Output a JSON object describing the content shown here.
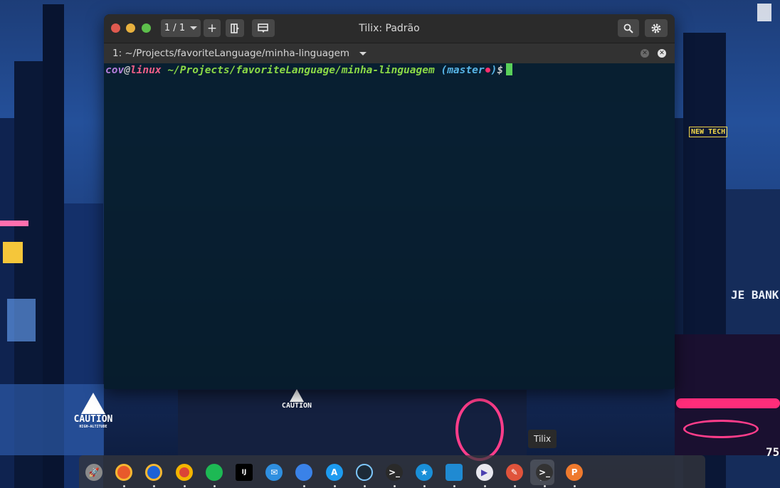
{
  "window": {
    "title": "Tilix: Padrão",
    "session_label": "1 / 1",
    "add_label": "+",
    "tab_label": "1: ~/Projects/favoriteLanguage/minha-linguagem"
  },
  "terminal": {
    "user": "cov",
    "at": "@",
    "host": "linux",
    "path": "~/Projects/favoriteLanguage/minha-linguagem",
    "paren_open": "(",
    "branch": "master",
    "paren_close": ")",
    "symbol": "$"
  },
  "colors": {
    "user": "#b57edc",
    "at": "#c0c0c0",
    "host": "#ef5e86",
    "path": "#8bd846",
    "branch": "#57b4e6",
    "dirty_dot": "#ff2d6d",
    "cursor": "#59d05a",
    "close_dot": "#e05a4f",
    "min_dot": "#e8b13e",
    "max_dot": "#5dbf4b"
  },
  "wallpaper_signs": {
    "new_tech": "NEW TECH",
    "je_bank": "JE BANK",
    "caution_left": "CAUTION",
    "caution_left_sub": "HIGH-ALTITUDE",
    "caution_mid": "CAUTION",
    "number": "75"
  },
  "dock": {
    "tooltip": "Tilix",
    "apps": [
      {
        "name": "rocket-icon",
        "glyph": "🚀",
        "color": "#8a8a8a"
      },
      {
        "name": "firefox-icon",
        "glyph": "",
        "color": "#e8592b"
      },
      {
        "name": "firefox-dev-icon",
        "glyph": "",
        "color": "#1d61d6"
      },
      {
        "name": "chrome-icon",
        "glyph": "",
        "color": "#db4437"
      },
      {
        "name": "spotify-icon",
        "glyph": "",
        "color": "#1db954"
      },
      {
        "name": "intellij-icon",
        "glyph": "IJ",
        "color": "#000000"
      },
      {
        "name": "mail-icon",
        "glyph": "✉",
        "color": "#2f8fe0"
      },
      {
        "name": "finder-icon",
        "glyph": "",
        "color": "#3a82e8"
      },
      {
        "name": "appstore-icon",
        "glyph": "A",
        "color": "#1d9bf0"
      },
      {
        "name": "gauge-icon",
        "glyph": "",
        "color": "#1d2b38"
      },
      {
        "name": "terminal-icon",
        "glyph": ">_",
        "color": "#2a2a2a"
      },
      {
        "name": "star-icon",
        "glyph": "★",
        "color": "#1a8fd8"
      },
      {
        "name": "vscode-icon",
        "glyph": "",
        "color": "#1f8ad2"
      },
      {
        "name": "media-player-icon",
        "glyph": "▶",
        "color": "#e8e8ef"
      },
      {
        "name": "pencil-icon",
        "glyph": "✎",
        "color": "#e0533b"
      },
      {
        "name": "tilix-icon",
        "glyph": ">_",
        "color": "#333333"
      },
      {
        "name": "postman-icon",
        "glyph": "P",
        "color": "#ef7a2e"
      }
    ]
  }
}
